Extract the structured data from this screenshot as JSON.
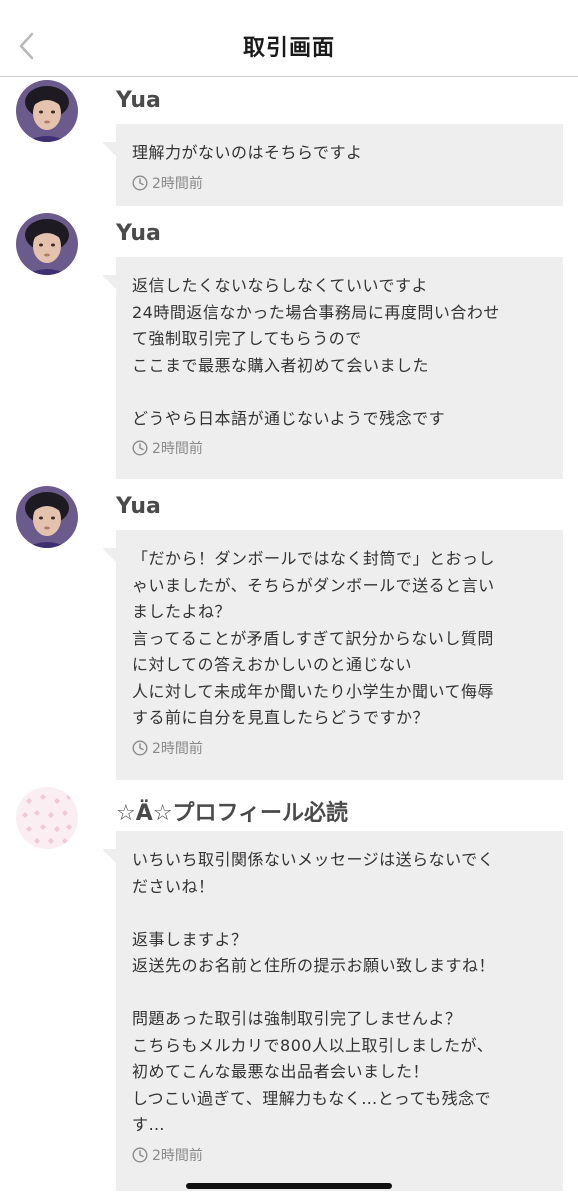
{
  "header": {
    "title": "取引画面",
    "back_icon": "chevron-left-icon"
  },
  "messages": [
    {
      "sender": "Yua",
      "lines": [
        "理解力がないのはそちらですよ"
      ],
      "time": "2時間前"
    },
    {
      "sender": "Yua",
      "lines": [
        "返信したくないならしなくていいですよ",
        "24時間返信なかった場合事務局に再度問い合わせ",
        "て強制取引完了してもらうので",
        "ここまで最悪な購入者初めて会いました",
        "",
        "どうやら日本語が通じないようで残念です"
      ],
      "time": "2時間前"
    },
    {
      "sender": "Yua",
      "lines": [
        "「だから！ダンボールではなく封筒で」とおっし",
        "ゃいましたが、そちらがダンボールで送ると言い",
        "ましたよね？",
        "言ってることが矛盾しすぎて訳分からないし質問",
        "に対しての答えおかしいのと通じない",
        "人に対して未成年か聞いたり小学生か聞いて侮辱",
        "する前に自分を見直したらどうですか？"
      ],
      "time": "2時間前"
    },
    {
      "sender": "☆Ä☆プロフィール必読",
      "lines": [
        "いちいち取引関係ないメッセージは送らないでく",
        "ださいね！",
        "",
        "返事しますよ？",
        "返送先のお名前と住所の提示お願い致しますね！",
        "",
        "問題あった取引は強制取引完了しませんよ？",
        "こちらもメルカリで800人以上取引しましたが、",
        "初めてこんな最悪な出品者会いました！",
        "しつこい過ぎて、理解力もなく…とっても残念で",
        "す…"
      ],
      "time": "2時間前"
    }
  ],
  "colors": {
    "bubble": "#eeeeee",
    "sender": "#4a4a4a",
    "timestamp": "#8a8a8a",
    "divider": "#cfcfcf"
  }
}
